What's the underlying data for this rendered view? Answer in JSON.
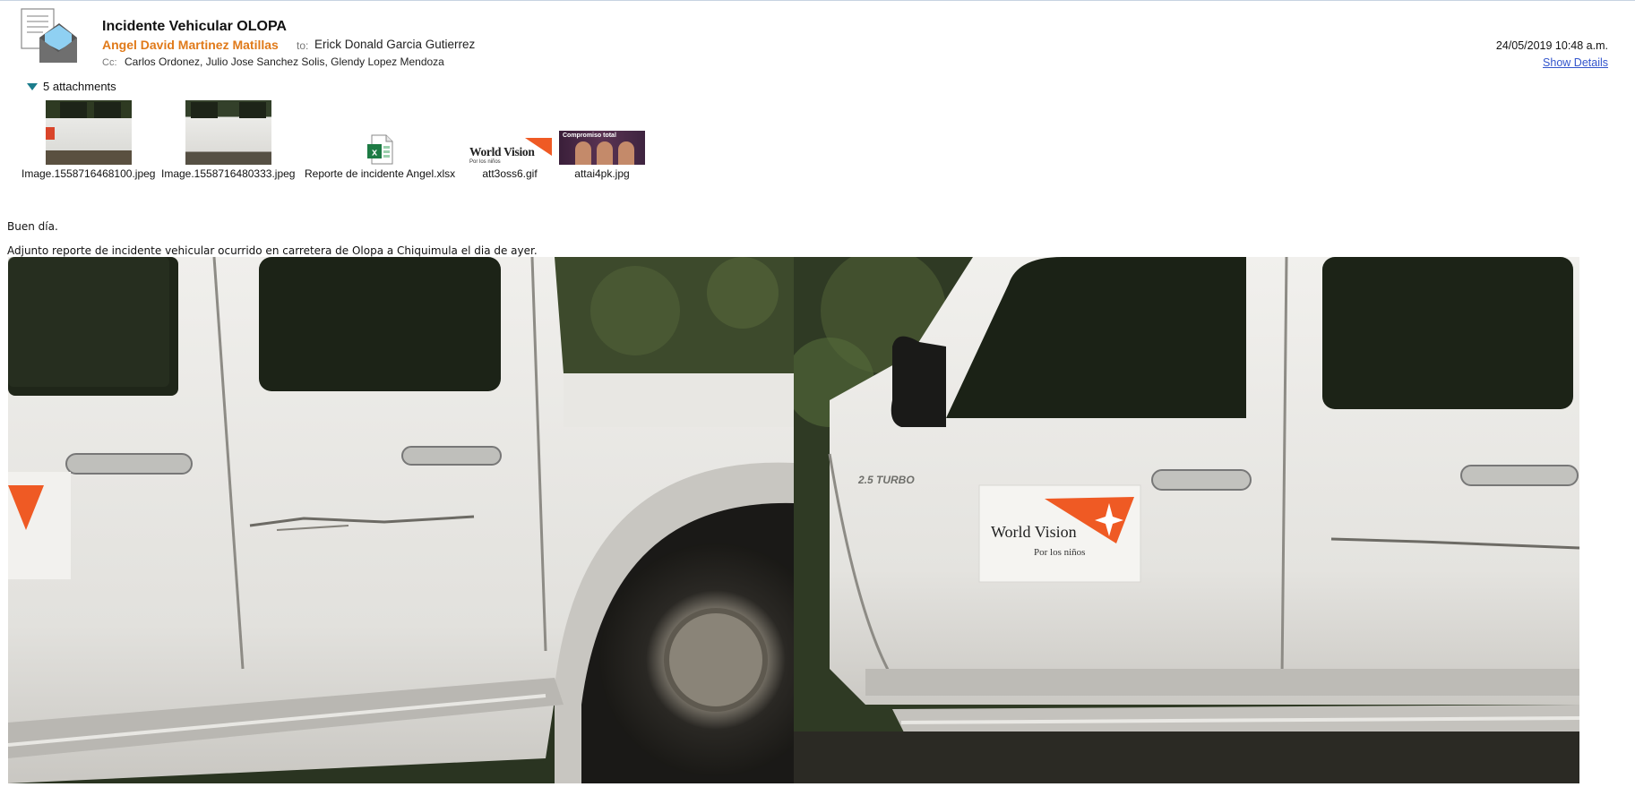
{
  "header": {
    "subject": "Incidente Vehicular OLOPA",
    "sender": "Angel David Martinez Matillas",
    "to_label": "to:",
    "to": "Erick Donald Garcia Gutierrez",
    "cc_label": "Cc:",
    "cc": "Carlos Ordonez, Julio Jose Sanchez Solis, Glendy Lopez Mendoza",
    "date": "24/05/2019 10:48 a.m.",
    "show_details": "Show Details"
  },
  "attachments": {
    "toggle_label": "5 attachments",
    "items": [
      {
        "name": "Image.1558716468100.jpeg",
        "icon": "image-thumbnail"
      },
      {
        "name": "Image.1558716480333.jpeg",
        "icon": "image-thumbnail"
      },
      {
        "name": "Reporte de incidente Angel.xlsx",
        "icon": "excel-icon"
      },
      {
        "name": "att3oss6.gif",
        "icon": "gif-thumbnail"
      },
      {
        "name": "attai4pk.jpg",
        "icon": "image-thumbnail"
      }
    ],
    "gif_thumb_title": "World Vision",
    "gif_thumb_sub": "Por los niños",
    "jpg_thumb_caption": "Compromiso total"
  },
  "body": {
    "greeting": "Buen día.",
    "line1": "Adjunto reporte de incidente vehicular ocurrido en carretera de Olopa a Chiquimula el dia de ayer.",
    "photo2_logo_title": "World Vision",
    "photo2_logo_sub": "Por los niños",
    "photo2_badge": "2.5 TURBO"
  },
  "colors": {
    "sender": "#e07a1a",
    "link": "#3355cc",
    "toggle": "#1a7c8c",
    "brand_orange": "#ef5a24"
  }
}
